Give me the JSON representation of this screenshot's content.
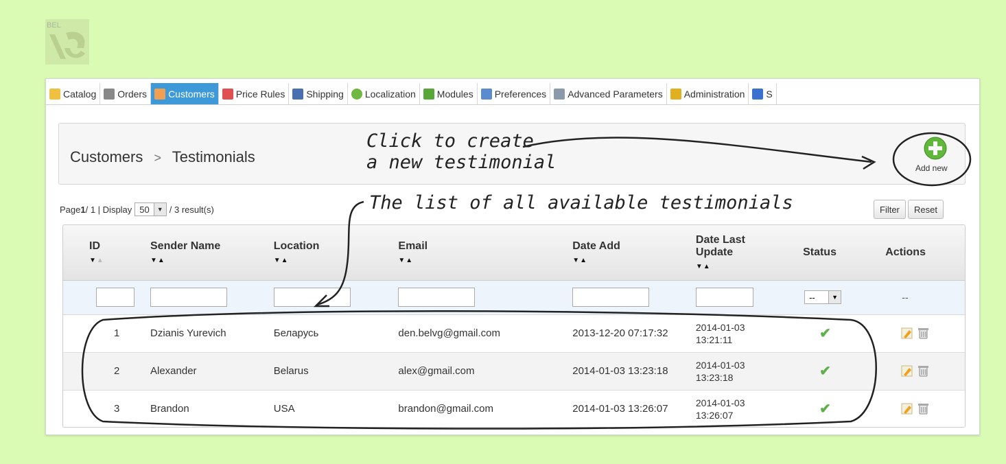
{
  "logo": {
    "text": "BEL",
    "icon": "belvg-logo-icon"
  },
  "menu": [
    {
      "label": "Catalog",
      "icon": "folder-icon",
      "color": "#f0c040"
    },
    {
      "label": "Orders",
      "icon": "cart-icon",
      "color": "#888888"
    },
    {
      "label": "Customers",
      "icon": "user-icon",
      "color": "#f0a050",
      "active": true
    },
    {
      "label": "Price Rules",
      "icon": "price-tag-icon",
      "color": "#e05050"
    },
    {
      "label": "Shipping",
      "icon": "truck-icon",
      "color": "#4a6fb0"
    },
    {
      "label": "Localization",
      "icon": "globe-icon",
      "color": "#70b840"
    },
    {
      "label": "Modules",
      "icon": "puzzle-icon",
      "color": "#58a838"
    },
    {
      "label": "Preferences",
      "icon": "edit-icon",
      "color": "#5a8ad0"
    },
    {
      "label": "Advanced Parameters",
      "icon": "wrench-icon",
      "color": "#8a9aaa"
    },
    {
      "label": "Administration",
      "icon": "key-icon",
      "color": "#e0b020"
    },
    {
      "label": "S",
      "icon": "stats-icon",
      "color": "#3a70d0"
    }
  ],
  "breadcrumb": {
    "parent": "Customers",
    "separator": ">",
    "current": "Testimonials"
  },
  "add_new": {
    "label": "Add new"
  },
  "annotations": {
    "create_line1": "Click to create",
    "create_line2": "a new testimonial",
    "list": "The list of all available testimonials"
  },
  "pagination": {
    "prefix": "Page ",
    "page": "1",
    "middle": " / 1 | Display",
    "per_page": "50",
    "results": "/ 3 result(s)"
  },
  "buttons": {
    "filter": "Filter",
    "reset": "Reset"
  },
  "table": {
    "columns": [
      {
        "label": "ID"
      },
      {
        "label": "Sender Name"
      },
      {
        "label": "Location"
      },
      {
        "label": "Email"
      },
      {
        "label": "Date Add"
      },
      {
        "label": "Date Last Update"
      },
      {
        "label": "Status"
      },
      {
        "label": "Actions"
      }
    ],
    "filter_status": "--",
    "filter_actions": "--",
    "rows": [
      {
        "id": "1",
        "sender": "Dzianis Yurevich",
        "location": "Беларусь",
        "email": "den.belvg@gmail.com",
        "date_add": "2013-12-20 07:17:32",
        "upd_date": "2014-01-03",
        "upd_time": "13:21:11"
      },
      {
        "id": "2",
        "sender": "Alexander",
        "location": "Belarus",
        "email": "alex@gmail.com",
        "date_add": "2014-01-03 13:23:18",
        "upd_date": "2014-01-03",
        "upd_time": "13:23:18"
      },
      {
        "id": "3",
        "sender": "Brandon",
        "location": "USA",
        "email": "brandon@gmail.com",
        "date_add": "2014-01-03 13:26:07",
        "upd_date": "2014-01-03",
        "upd_time": "13:26:07"
      }
    ]
  },
  "colors": {
    "background": "#d9fbb3",
    "active_tab": "#3e99d9",
    "status_ok": "#5fb04c"
  }
}
